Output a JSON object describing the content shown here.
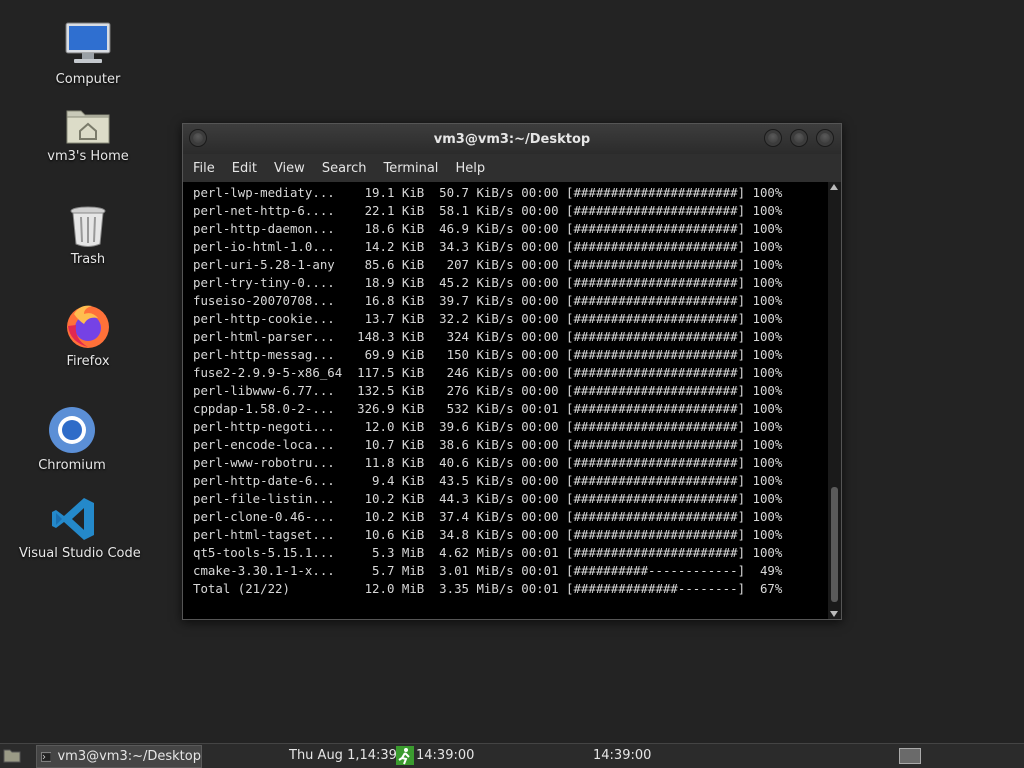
{
  "desktop": {
    "icons": [
      {
        "label": "Computer",
        "icon": "computer-icon"
      },
      {
        "label": "vm3's Home",
        "icon": "home-folder-icon"
      },
      {
        "label": "Trash",
        "icon": "trash-icon"
      },
      {
        "label": "Firefox",
        "icon": "firefox-icon"
      },
      {
        "label": "Chromium",
        "icon": "chromium-icon"
      },
      {
        "label": "Visual Studio Code",
        "icon": "vscode-icon"
      }
    ]
  },
  "window": {
    "title": "vm3@vm3:~/Desktop",
    "menu": [
      "File",
      "Edit",
      "View",
      "Search",
      "Terminal",
      "Help"
    ],
    "lines": [
      "perl-lwp-mediaty...    19.1 KiB  50.7 KiB/s 00:00 [######################] 100%",
      "perl-net-http-6....    22.1 KiB  58.1 KiB/s 00:00 [######################] 100%",
      "perl-http-daemon...    18.6 KiB  46.9 KiB/s 00:00 [######################] 100%",
      "perl-io-html-1.0...    14.2 KiB  34.3 KiB/s 00:00 [######################] 100%",
      "perl-uri-5.28-1-any    85.6 KiB   207 KiB/s 00:00 [######################] 100%",
      "perl-try-tiny-0....    18.9 KiB  45.2 KiB/s 00:00 [######################] 100%",
      "fuseiso-20070708...    16.8 KiB  39.7 KiB/s 00:00 [######################] 100%",
      "perl-http-cookie...    13.7 KiB  32.2 KiB/s 00:00 [######################] 100%",
      "perl-html-parser...   148.3 KiB   324 KiB/s 00:00 [######################] 100%",
      "perl-http-messag...    69.9 KiB   150 KiB/s 00:00 [######################] 100%",
      "fuse2-2.9.9-5-x86_64  117.5 KiB   246 KiB/s 00:00 [######################] 100%",
      "perl-libwww-6.77...   132.5 KiB   276 KiB/s 00:00 [######################] 100%",
      "cppdap-1.58.0-2-...   326.9 KiB   532 KiB/s 00:01 [######################] 100%",
      "perl-http-negoti...    12.0 KiB  39.6 KiB/s 00:00 [######################] 100%",
      "perl-encode-loca...    10.7 KiB  38.6 KiB/s 00:00 [######################] 100%",
      "perl-www-robotru...    11.8 KiB  40.6 KiB/s 00:00 [######################] 100%",
      "perl-http-date-6...     9.4 KiB  43.5 KiB/s 00:00 [######################] 100%",
      "perl-file-listin...    10.2 KiB  44.3 KiB/s 00:00 [######################] 100%",
      "perl-clone-0.46-...    10.2 KiB  37.4 KiB/s 00:00 [######################] 100%",
      "perl-html-tagset...    10.6 KiB  34.8 KiB/s 00:00 [######################] 100%",
      "qt5-tools-5.15.1...     5.3 MiB  4.62 MiB/s 00:01 [######################] 100%",
      "cmake-3.30.1-1-x...     5.7 MiB  3.01 MiB/s 00:01 [##########------------]  49%",
      "Total (21/22)          12.0 MiB  3.35 MiB/s 00:01 [##############--------]  67%"
    ]
  },
  "taskbar": {
    "task_label": "vm3@vm3:~/Desktop",
    "clock_date": "Thu Aug  1,14:39",
    "clock_time": "14:39:00",
    "clock_time2": "14:39:00"
  },
  "colors": {
    "desktop_bg": "#232323",
    "terminal_bg": "#000000",
    "terminal_fg": "#d8d8d8",
    "vscode_blue": "#2489ca",
    "firefox_orange": "#ff7139"
  }
}
